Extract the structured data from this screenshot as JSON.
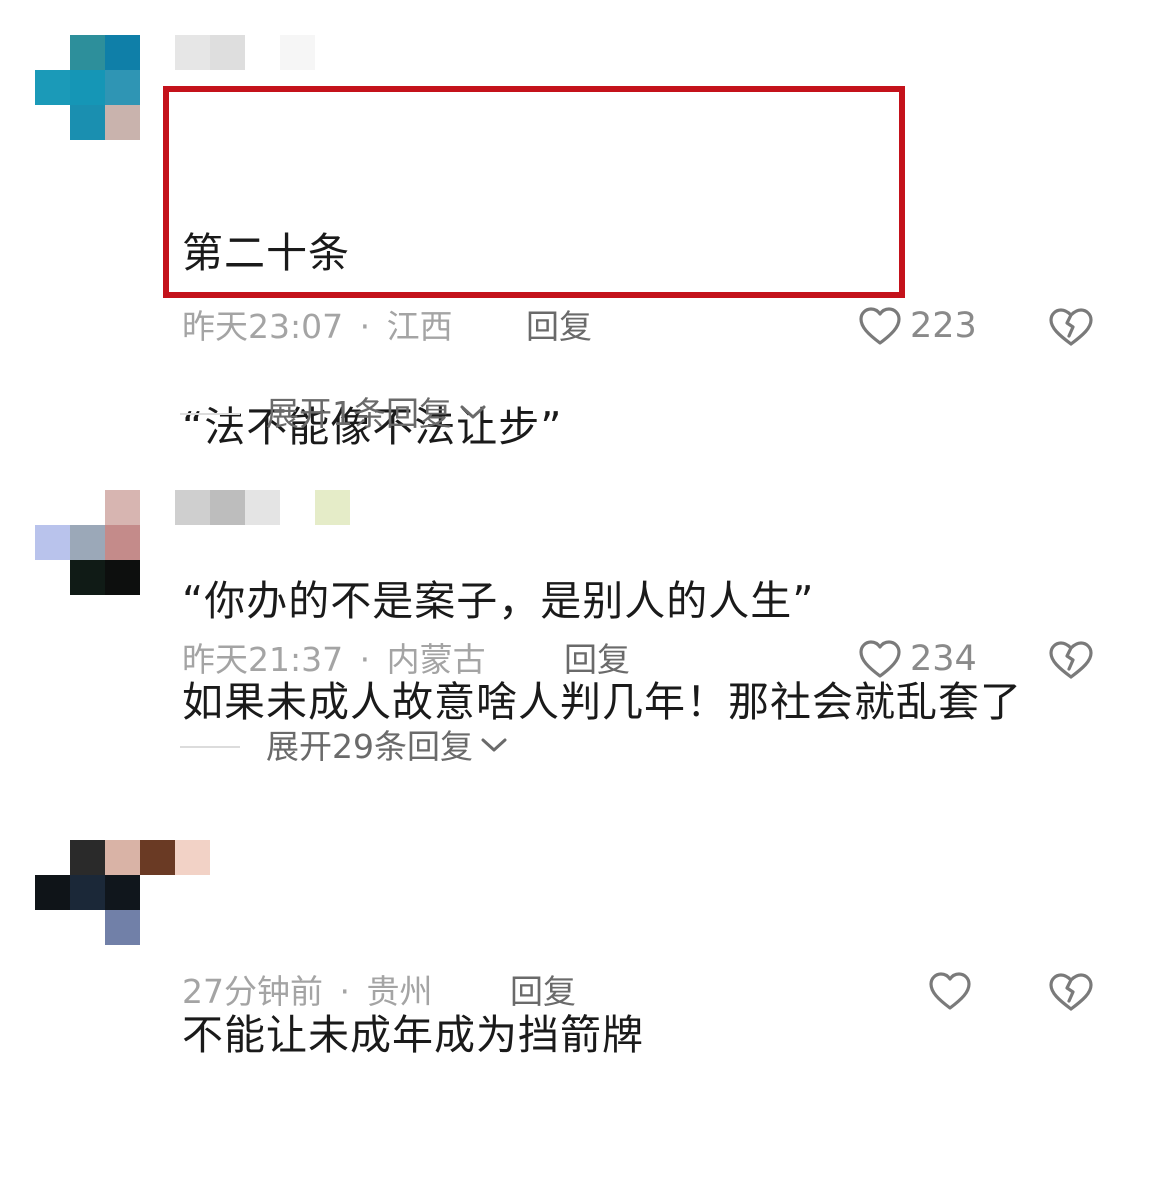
{
  "comments": [
    {
      "content_lines": [
        "第二十条",
        "“法不能像不法让步”",
        "“你办的不是案子，是别人的人生”"
      ],
      "time": "昨天23:07",
      "location": "江西",
      "reply_label": "回复",
      "likes": "223",
      "expand_label": "展开1条回复"
    },
    {
      "content_lines": [
        "如果未成人故意啥人判几年！那社会就乱套了"
      ],
      "time": "昨天21:37",
      "location": "内蒙古",
      "reply_label": "回复",
      "likes": "234",
      "expand_label": "展开29条回复"
    },
    {
      "content_lines": [
        "不能让未成年成为挡箭牌"
      ],
      "time": "27分钟前",
      "location": "贵州",
      "reply_label": "回复",
      "likes": ""
    }
  ],
  "meta_separator": "·",
  "colors": {
    "highlight_border": "#c4121b",
    "text": "#1a1a1a",
    "meta": "#a4a4a4",
    "icon": "#7a7a7a"
  },
  "icons": [
    "heart-icon",
    "broken-heart-icon",
    "chevron-down-icon"
  ]
}
